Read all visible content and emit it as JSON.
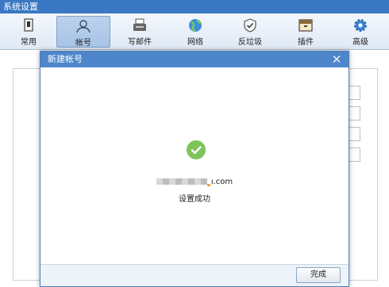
{
  "window": {
    "title": "系统设置"
  },
  "toolbar": {
    "items": [
      {
        "label": "常用",
        "icon": "common-icon"
      },
      {
        "label": "帐号",
        "icon": "account-icon",
        "active": true
      },
      {
        "label": "写邮件",
        "icon": "compose-mail-icon"
      },
      {
        "label": "网络",
        "icon": "network-icon"
      },
      {
        "label": "反垃圾",
        "icon": "anti-spam-icon"
      },
      {
        "label": "插件",
        "icon": "plugin-icon"
      },
      {
        "label": "高级",
        "icon": "gear-icon"
      }
    ]
  },
  "dialog": {
    "title": "新建帐号",
    "email_suffix": "ı.com",
    "status": "设置成功",
    "done_label": "完成",
    "success_color": "#7dc45a"
  }
}
